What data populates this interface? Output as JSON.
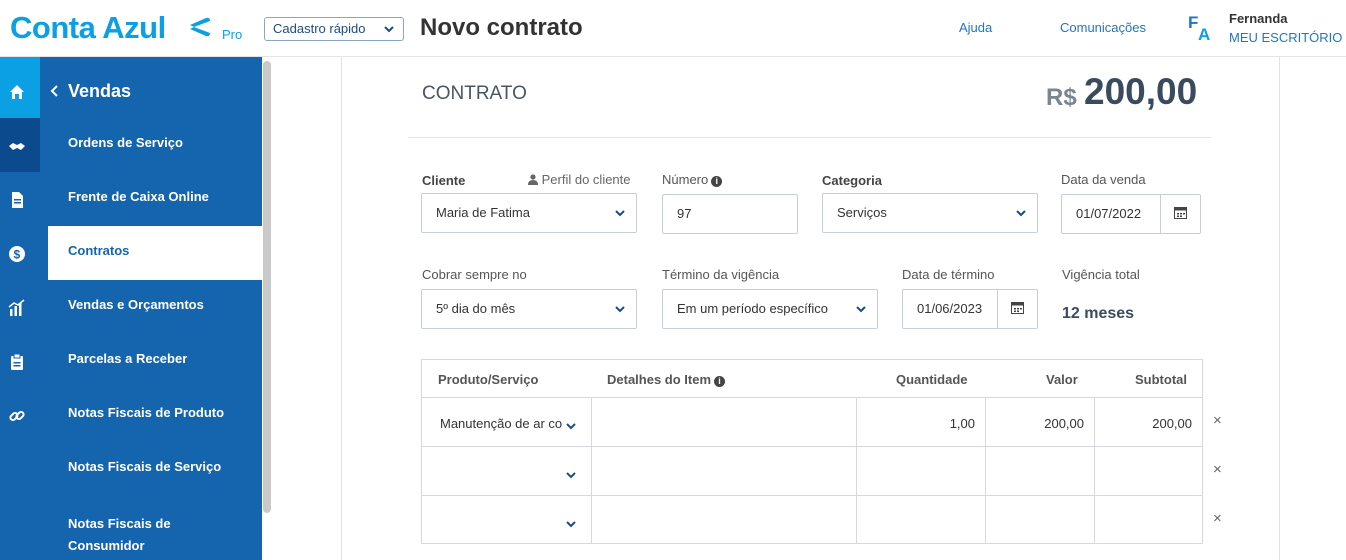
{
  "header": {
    "logo_text": "Conta Azul",
    "plan": "Pro",
    "quick_register": "Cadastro rápido",
    "page_title": "Novo contrato",
    "links": [
      "Ajuda",
      "Comunicações"
    ],
    "avatar_initials": "FA",
    "user_name": "Fernanda",
    "user_office": "MEU ESCRITÓRIO"
  },
  "sidebar": {
    "back_icon": "chevron-left-icon",
    "title": "Vendas",
    "rail_icons": [
      "home-icon",
      "handshake-icon",
      "document-icon",
      "dollar-icon",
      "chart-icon",
      "clipboard-icon",
      "link-icon"
    ],
    "items": [
      {
        "label": "Ordens de Serviço",
        "active": false
      },
      {
        "label": "Frente de Caixa Online",
        "active": false
      },
      {
        "label": "Contratos",
        "active": true
      },
      {
        "label": "Vendas e Orçamentos",
        "active": false
      },
      {
        "label": "Parcelas a Receber",
        "active": false
      },
      {
        "label": "Notas Fiscais de Produto",
        "active": false
      },
      {
        "label": "Notas Fiscais de Serviço",
        "active": false
      },
      {
        "label": "Notas Fiscais de Consumidor",
        "active": false
      }
    ]
  },
  "contract": {
    "section_title": "CONTRATO",
    "currency": "R$",
    "total": "200,00"
  },
  "form": {
    "client_label": "Cliente",
    "client_profile_link": "Perfil do cliente",
    "client_value": "Maria de Fatima",
    "number_label": "Número",
    "number_value": "97",
    "category_label": "Categoria",
    "category_value": "Serviços",
    "sale_date_label": "Data da venda",
    "sale_date_value": "01/07/2022",
    "charge_label": "Cobrar sempre no",
    "charge_value": "5º dia do mês",
    "term_label": "Término da vigência",
    "term_value": "Em um período específico",
    "end_date_label": "Data de término",
    "end_date_value": "01/06/2023",
    "total_term_label": "Vigência total",
    "total_term_value": "12 meses"
  },
  "items_table": {
    "headers": {
      "product": "Produto/Serviço",
      "details": "Detalhes do Item",
      "quantity": "Quantidade",
      "value": "Valor",
      "subtotal": "Subtotal"
    },
    "rows": [
      {
        "product": "Manutenção de ar co",
        "details": "",
        "quantity": "1,00",
        "value": "200,00",
        "subtotal": "200,00"
      },
      {
        "product": "",
        "details": "",
        "quantity": "",
        "value": "",
        "subtotal": ""
      },
      {
        "product": "",
        "details": "",
        "quantity": "",
        "value": "",
        "subtotal": ""
      }
    ],
    "remove_symbol": "×"
  },
  "colors": {
    "brand": "#0aa0e3",
    "sidebar": "#1565ae",
    "link": "#1f75c6"
  }
}
